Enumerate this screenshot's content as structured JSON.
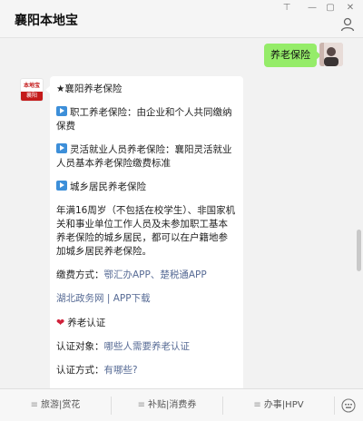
{
  "app": {
    "title": "襄阳本地宝"
  },
  "window_controls": [
    "⊤",
    "—",
    "▢",
    "✕"
  ],
  "icons": {
    "user": "user-icon",
    "keyboard": "keyboard-icon",
    "play": "play-icon",
    "heart": "heart-icon"
  },
  "colors": {
    "outgoing_bubble": "#95ec69",
    "link": "#576b95",
    "heart": "#d0213a",
    "play_icon": "#3d8fd9"
  },
  "chat": {
    "outgoing": {
      "text": "养老保险"
    },
    "incoming": {
      "avatar_top": "本地宝",
      "avatar_bottom": "襄阳",
      "title": "★襄阳养老保险",
      "item1": "职工养老保险：由企业和个人共同缴纳保费",
      "item2": "灵活就业人员养老保险：襄阳灵活就业人员基本养老保险缴费标准",
      "item3": "城乡居民养老保险",
      "body": "年满16周岁（不包括在校学生）、非国家机关和事业单位工作人员及未参加职工基本养老保险的城乡居民，都可以在户籍地参加城乡居民养老保险。",
      "pay_label": "缴费方式：",
      "pay_link1": "鄂汇办APP",
      "pay_sep": "、",
      "pay_link2": "楚税通APP",
      "link3": "湖北政务网",
      "link_sep": " | ",
      "link4": "APP下载",
      "cert_title": "养老认证",
      "cert_target_label": "认证对象：",
      "cert_target_link": "哪些人需要养老认证",
      "cert_method_label": "认证方式：",
      "cert_method_link": "有哪些?"
    }
  },
  "bottom_menu": [
    "旅游|赏花",
    "补贴|消费券",
    "办事|HPV"
  ]
}
